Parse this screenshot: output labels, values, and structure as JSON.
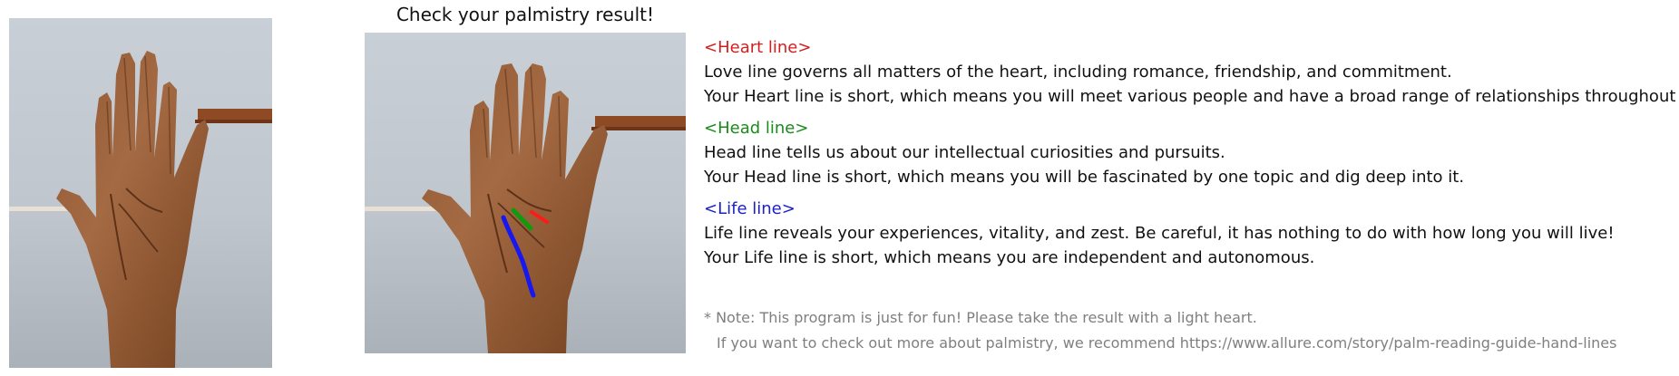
{
  "header": {
    "title": "Check your palmistry result!"
  },
  "images": {
    "original_hand": "left-hand-photo",
    "annotated_hand": "annotated-hand-photo"
  },
  "results": [
    {
      "title": "<Heart line>",
      "line1": "Love line governs all matters of the heart, including romance, friendship, and commitment.",
      "line2": "Your Heart line is short, which means you will meet various people and have a broad range of relationships throughout your life.",
      "color": "#d21f1f"
    },
    {
      "title": "<Head line>",
      "line1": "Head line tells us about our intellectual curiosities and pursuits.",
      "line2": "Your Head line is short, which means you will be fascinated by one topic and dig deep into it.",
      "color": "#1a8b1a"
    },
    {
      "title": "<Life line>",
      "line1": "Life line reveals your experiences, vitality, and zest. Be careful, it has nothing to do with how long you will live!",
      "line2": "Your Life line is short, which means you are independent and autonomous.",
      "color": "#1d22c7"
    }
  ],
  "notes": {
    "line1": "* Note: This program is just for fun! Please take the result with a light heart.",
    "line2": "If you want to check out more about palmistry, we recommend https://www.allure.com/story/palm-reading-guide-hand-lines"
  }
}
